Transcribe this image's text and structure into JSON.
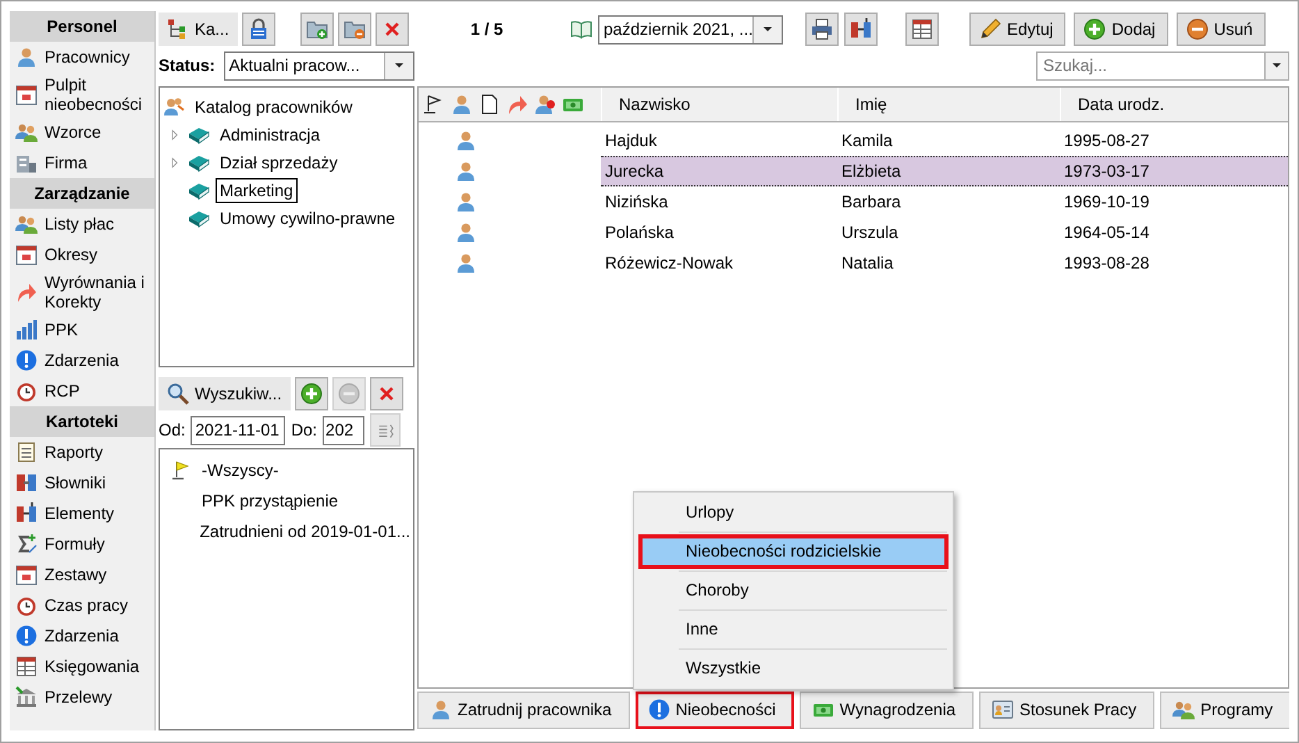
{
  "sidebar": {
    "sections": [
      {
        "title": "Personel",
        "items": [
          {
            "label": "Pracownicy"
          },
          {
            "label": "Pulpit nieobecności"
          },
          {
            "label": "Wzorce"
          },
          {
            "label": "Firma"
          }
        ]
      },
      {
        "title": "Zarządzanie",
        "items": [
          {
            "label": "Listy płac"
          },
          {
            "label": "Okresy"
          },
          {
            "label": "Wyrównania i Korekty"
          },
          {
            "label": "PPK"
          },
          {
            "label": "Zdarzenia"
          },
          {
            "label": "RCP"
          }
        ]
      },
      {
        "title": "Kartoteki",
        "items": [
          {
            "label": "Raporty"
          },
          {
            "label": "Słowniki"
          },
          {
            "label": "Elementy"
          },
          {
            "label": "Formuły"
          },
          {
            "label": "Zestawy"
          },
          {
            "label": "Czas pracy"
          },
          {
            "label": "Zdarzenia"
          },
          {
            "label": "Księgowania"
          },
          {
            "label": "Przelewy"
          }
        ]
      }
    ]
  },
  "left_panel": {
    "catalog_button": "Ka...",
    "status": {
      "label": "Status:",
      "value": "Aktualni pracow..."
    },
    "tree": {
      "root": "Katalog pracowników",
      "children": [
        {
          "label": "Administracja",
          "expandable": true,
          "selected": false
        },
        {
          "label": "Dział sprzedaży",
          "expandable": true,
          "selected": false
        },
        {
          "label": "Marketing",
          "expandable": false,
          "selected": true
        },
        {
          "label": "Umowy cywilno-prawne",
          "expandable": false,
          "selected": false
        }
      ]
    }
  },
  "filters": {
    "search_button": "Wyszukiw...",
    "remove_disabled": true,
    "from_label": "Od:",
    "from": "2021-11-01",
    "to_label": "Do:",
    "to": "202",
    "items": [
      {
        "label": "-Wszyscy-",
        "flag": true
      },
      {
        "label": "PPK przystąpienie",
        "flag": false
      },
      {
        "label": "Zatrudnieni od 2019-01-01...",
        "flag": false
      }
    ]
  },
  "grid": {
    "counter": "1 / 5",
    "period": "październik 2021, ...",
    "actions": [
      "Edytuj",
      "Dodaj",
      "Usuń"
    ],
    "search": {
      "placeholder": "Szukaj..."
    },
    "columns": [
      "Nazwisko",
      "Imię",
      "Data urodz."
    ],
    "rows": [
      {
        "cells": [
          "Hajduk",
          "Kamila",
          "1995-08-27"
        ],
        "selected": false
      },
      {
        "cells": [
          "Jurecka",
          "Elżbieta",
          "1973-03-17"
        ],
        "selected": true
      },
      {
        "cells": [
          "Nizińska",
          "Barbara",
          "1969-10-19"
        ],
        "selected": false
      },
      {
        "cells": [
          "Polańska",
          "Urszula",
          "1964-05-14"
        ],
        "selected": false
      },
      {
        "cells": [
          "Różewicz-Nowak",
          "Natalia",
          "1993-08-28"
        ],
        "selected": false
      }
    ]
  },
  "menu": {
    "items": [
      {
        "label": "Urlopy",
        "selected": false,
        "highlighted": false
      },
      {
        "label": "Nieobecności rodzicielskie",
        "selected": true,
        "highlighted": true
      },
      {
        "label": "Choroby",
        "selected": false,
        "highlighted": false
      },
      {
        "label": "Inne",
        "selected": false,
        "highlighted": false
      },
      {
        "label": "Wszystkie",
        "selected": false,
        "highlighted": false
      }
    ]
  },
  "bottom_buttons": [
    {
      "label": "Zatrudnij pracownika",
      "highlighted": false
    },
    {
      "label": "Nieobecności",
      "highlighted": true
    },
    {
      "label": "Wynagrodzenia",
      "highlighted": false
    },
    {
      "label": "Stosunek Pracy",
      "highlighted": false
    },
    {
      "label": "Programy",
      "highlighted": false
    }
  ]
}
